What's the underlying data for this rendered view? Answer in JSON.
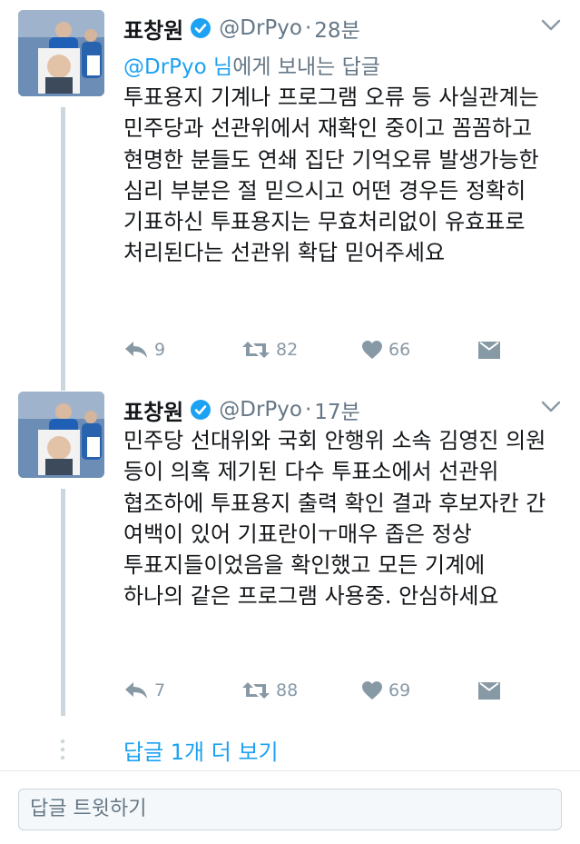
{
  "tweets": [
    {
      "name": "표창원",
      "handle": "@DrPyo",
      "separator": "·",
      "time": "28분",
      "reply_to_mention": "@DrPyo 님",
      "reply_to_suffix": "에게 보내는 답글",
      "text": "투표용지 기계나 프로그램 오류 등 사실관계는 민주당과 선관위에서 재확인 중이고 꼼꼼하고 현명한 분들도 연쇄 집단 기억오류 발생가능한 심리 부분은 절 믿으시고 어떤 경우든 정확히 기표하신 투표용지는 무효처리없이 유효표로 처리된다는 선관위 확답 믿어주세요",
      "replies": "9",
      "retweets": "82",
      "likes": "66"
    },
    {
      "name": "표창원",
      "handle": "@DrPyo",
      "separator": "·",
      "time": "17분",
      "text": "민주당 선대위와 국회 안행위 소속 김영진 의원 등이 의혹 제기된 다수 투표소에서 선관위 협조하에 투표용지 출력 확인 결과 후보자칸 간 여백이 있어 기표란이ㅜ매우 좁은 정상 투표지들이었음을 확인했고 모든 기계에 하나의 같은 프로그램 사용중. 안심하세요",
      "replies": "7",
      "retweets": "88",
      "likes": "69"
    }
  ],
  "more_replies_label": "답글 1개 더 보기",
  "composer_placeholder": "답글 트윗하기",
  "colors": {
    "accent": "#1da1f2",
    "muted": "#657786",
    "icon": "#8899a6",
    "thread_line": "#ccd6dd"
  },
  "icons": [
    "verified-badge-icon",
    "chevron-down-icon",
    "reply-icon",
    "retweet-icon",
    "heart-icon",
    "direct-message-icon",
    "more-dots-icon"
  ]
}
